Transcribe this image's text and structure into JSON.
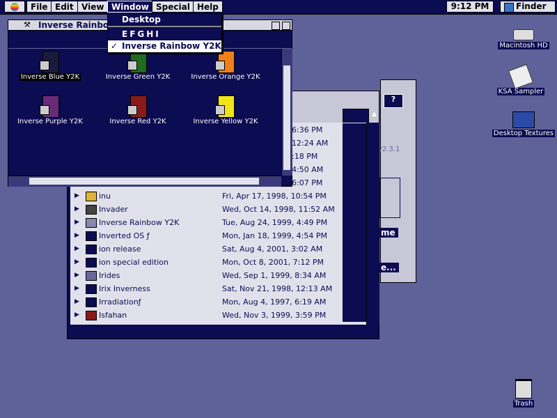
{
  "menubar": {
    "items": [
      "File",
      "Edit",
      "View",
      "Window",
      "Special",
      "Help"
    ],
    "clock": "9:12 PM",
    "app": "Finder"
  },
  "window_menu": {
    "items": [
      {
        "label": "Desktop",
        "checked": false
      },
      {
        "label": "EFGHI",
        "checked": false
      },
      {
        "label": "Inverse Rainbow Y2K",
        "checked": true
      }
    ],
    "checkmark": "✓"
  },
  "rainbow_window": {
    "title": "Inverse Rainbow",
    "icons": [
      {
        "label": "Inverse Blue Y2K",
        "color": "#1a1a3c",
        "selected": true
      },
      {
        "label": "Inverse Green Y2K",
        "color": "#1f6b1f"
      },
      {
        "label": "Inverse Orange Y2K",
        "color": "#f07f19"
      },
      {
        "label": "Inverse Purple Y2K",
        "color": "#6a2a7a"
      },
      {
        "label": "Inverse Red Y2K",
        "color": "#8a1a1a"
      },
      {
        "label": "Inverse Yellow Y2K",
        "color": "#f0e419"
      }
    ]
  },
  "list_window": {
    "partial_times": [
      "6:36 PM",
      "12:24 AM",
      ":18 PM",
      "4:50 AM",
      "6:07 PM"
    ],
    "rows": [
      {
        "name": "inu",
        "date": "Fri, Apr 17, 1998, 10:54 PM",
        "icon": "#e0b43a"
      },
      {
        "name": "Invader",
        "date": "Wed, Oct 14, 1998, 11:52 AM",
        "icon": "#444444"
      },
      {
        "name": "Inverse Rainbow Y2K",
        "date": "Tue, Aug 24, 1999, 4:49 PM",
        "icon": "#8888aa"
      },
      {
        "name": "Inverted OS ƒ",
        "date": "Mon, Jan 18, 1999, 4:54 PM",
        "icon": "#0c0c52"
      },
      {
        "name": "ion release",
        "date": "Sat, Aug 4, 2001, 3:02 AM",
        "icon": "#0c0c52"
      },
      {
        "name": "ion special edition",
        "date": "Mon, Oct 8, 2001, 7:12 PM",
        "icon": "#0c0c52"
      },
      {
        "name": "Irides",
        "date": "Wed, Sep 1, 1999, 8:34 AM",
        "icon": "#6a6a9a"
      },
      {
        "name": "Irix Inverness",
        "date": "Sat, Nov 21, 1998, 12:13 AM",
        "icon": "#0c0c52"
      },
      {
        "name": "Irradiationƒ",
        "date": "Mon, Aug 4, 1997, 6:19 AM",
        "icon": "#0c0c52"
      },
      {
        "name": "Isfahan",
        "date": "Wed, Nov 3, 1999, 3:59 PM",
        "icon": "#8a1a1a"
      }
    ]
  },
  "ksa_partial": {
    "version": "v2.3.1",
    "btn1": "me",
    "btn2": "e..."
  },
  "desktop": {
    "icons": [
      "Macintosh HD",
      "KSA Sampler",
      "Desktop Textures",
      "Trash"
    ]
  }
}
